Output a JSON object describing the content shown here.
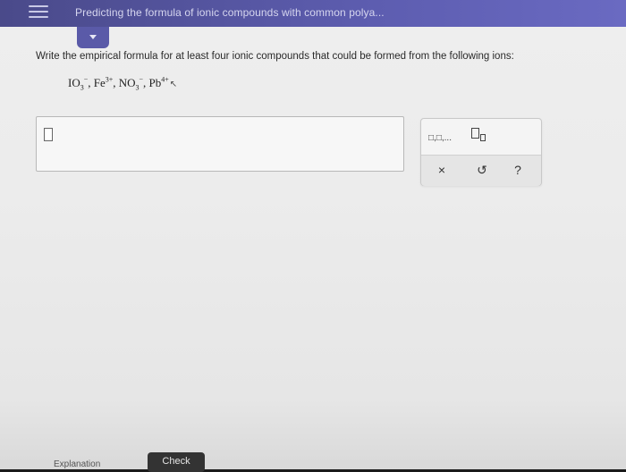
{
  "header": {
    "title": "Predicting the formula of ionic compounds with common polya...",
    "menu_icon": "hamburger-menu-icon",
    "collapse_icon": "chevron-down-icon"
  },
  "question": {
    "prompt": "Write the empirical formula for at least four ionic compounds that could be formed from the following ions:",
    "ions": [
      {
        "base": "IO",
        "sub": "3",
        "sup": "−"
      },
      {
        "base": "Fe",
        "sub": "",
        "sup": "3+"
      },
      {
        "base": "NO",
        "sub": "3",
        "sup": "−"
      },
      {
        "base": "Pb",
        "sub": "",
        "sup": "4+"
      }
    ],
    "separator": ", "
  },
  "answer": {
    "value": ""
  },
  "tools": {
    "subscript_label": "□,□,...",
    "superscript_icon": "superscript-icon",
    "clear_label": "×",
    "undo_label": "↺",
    "help_label": "?"
  },
  "footer": {
    "explanation_label": "Explanation",
    "check_label": "Check"
  },
  "colors": {
    "header_bg": "#5050a0",
    "check_bg": "#333333"
  }
}
